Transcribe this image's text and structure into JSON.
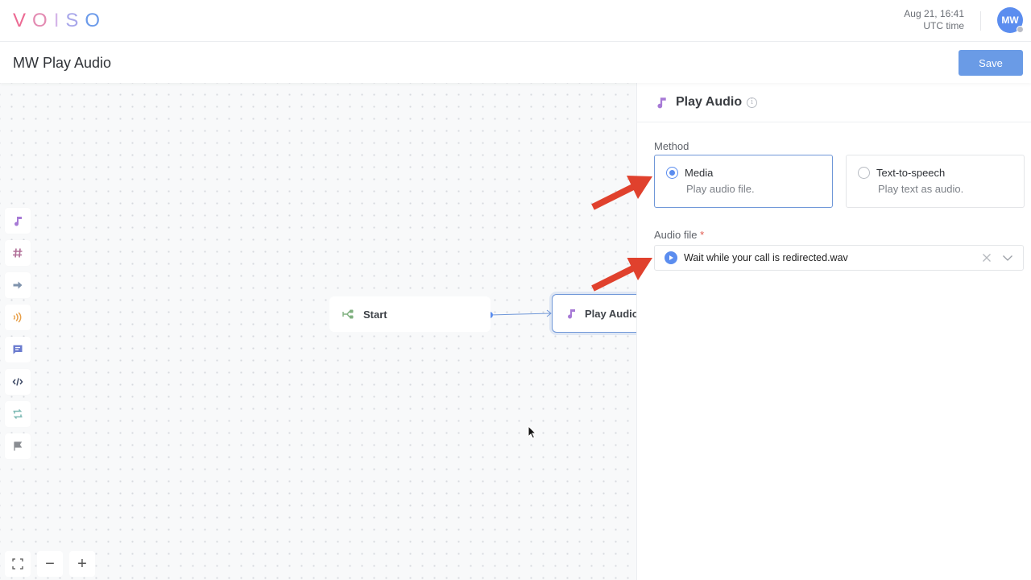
{
  "header": {
    "logo_letters": [
      {
        "char": "V",
        "color": "#ec6a93"
      },
      {
        "char": "O",
        "color": "#e38bb2"
      },
      {
        "char": "I",
        "color": "#d4b5e8"
      },
      {
        "char": "S",
        "color": "#a8a7ea"
      },
      {
        "char": "O",
        "color": "#6c9bea"
      }
    ],
    "date": "Aug 21, 16:41",
    "timezone": "UTC time",
    "avatar_initials": "MW"
  },
  "titlebar": {
    "title": "MW Play Audio",
    "save_label": "Save"
  },
  "toolbox": {
    "items": [
      {
        "icon": "music-note-icon",
        "color": "#a77ad6"
      },
      {
        "icon": "hash-icon",
        "color": "#b06e97"
      },
      {
        "icon": "arrow-right-icon",
        "color": "#7f93ad"
      },
      {
        "icon": "broadcast-icon",
        "color": "#e8a04a"
      },
      {
        "icon": "chat-icon",
        "color": "#6b7ccf"
      },
      {
        "icon": "code-icon",
        "color": "#3e4a66"
      },
      {
        "icon": "repeat-icon",
        "color": "#7db9b4"
      },
      {
        "icon": "flag-icon",
        "color": "#8a8d92"
      }
    ]
  },
  "flow": {
    "nodes": [
      {
        "label": "Start",
        "icon": "flow-start-icon"
      },
      {
        "label": "Play Audio",
        "icon": "music-note-icon"
      }
    ]
  },
  "zoom_controls": {
    "fit": "fit-screen-icon",
    "zoom_out": "−",
    "zoom_in": "+"
  },
  "panel": {
    "title": "Play Audio",
    "method_label": "Method",
    "options": [
      {
        "title": "Media",
        "desc": "Play audio file.",
        "selected": true
      },
      {
        "title": "Text-to-speech",
        "desc": "Play text as audio.",
        "selected": false
      }
    ],
    "audio_label": "Audio file",
    "required_mark": "*",
    "audio_value": "Wait while your call is redirected.wav"
  },
  "colors": {
    "accent": "#5b8def",
    "save_button": "#6a9be6",
    "annotation_arrow": "#e0412d"
  }
}
